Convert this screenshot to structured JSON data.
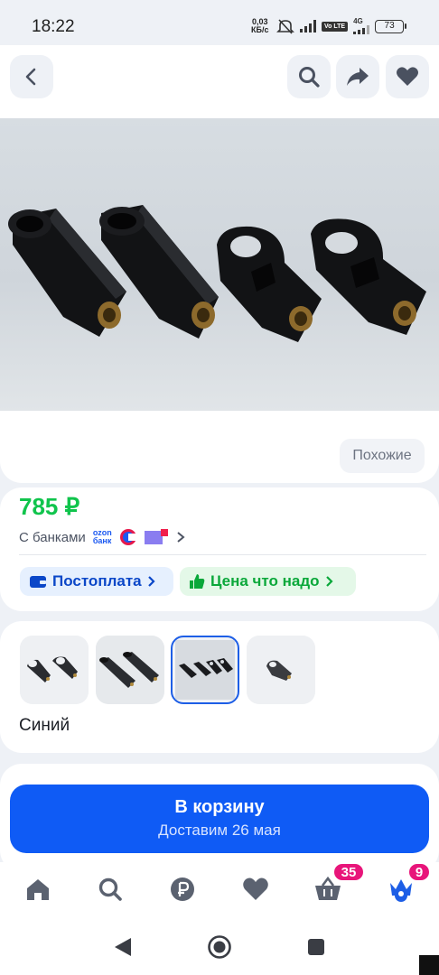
{
  "status_bar": {
    "time": "18:22",
    "net_speed": "0,03",
    "net_unit": "КБ/с",
    "volte": "Vo LTE",
    "network": "4G",
    "battery": "73"
  },
  "header": {
    "back_icon": "chevron-left-icon",
    "search_icon": "search-icon",
    "share_icon": "share-icon",
    "favorite_icon": "heart-icon"
  },
  "gallery": {
    "similar_label": "Похожие"
  },
  "price": {
    "value": "785 ₽",
    "banks_label": "С банками",
    "ozon_line1": "ozon",
    "ozon_line2": "банк"
  },
  "chips": {
    "postpay": "Постоплата",
    "fair_price": "Цена что надо"
  },
  "variants": {
    "selected_index": 2,
    "color_name": "Синий"
  },
  "cart": {
    "button_label": "В корзину",
    "delivery": "Доставим 26 мая"
  },
  "tabbar": {
    "cart_badge": "35",
    "profile_badge": "9"
  },
  "colors": {
    "accent": "#0f5bf5",
    "price_green": "#10c44c",
    "badge_pink": "#e8157a"
  }
}
